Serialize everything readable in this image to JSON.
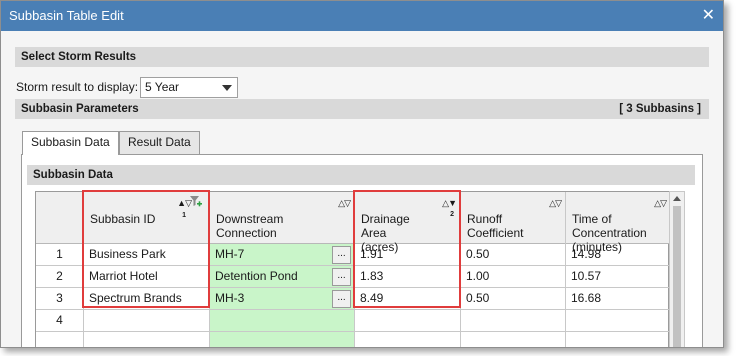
{
  "window": {
    "title": "Subbasin Table Edit",
    "close_glyph": "✕"
  },
  "storm": {
    "header": "Select Storm Results",
    "label": "Storm result to display:",
    "selected": "5 Year"
  },
  "params": {
    "header": "Subbasin Parameters",
    "count": "[ 3 Subbasins ]"
  },
  "tabs": [
    {
      "label": "Subbasin Data",
      "active": true
    },
    {
      "label": "Result Data",
      "active": false
    }
  ],
  "panel_header": "Subbasin Data",
  "columns": [
    {
      "label": "Subbasin ID",
      "sort": "▲▽",
      "sort_order": "1"
    },
    {
      "label": "Downstream\nConnection",
      "sort": "△▽"
    },
    {
      "label": "Drainage\nArea\n(acres)",
      "sort": "△▼",
      "sort_order": "2"
    },
    {
      "label": "Runoff\nCoefficient",
      "sort": "△▽"
    },
    {
      "label": "Time of\nConcentration\n(minutes)",
      "sort": "△▽"
    }
  ],
  "rows": [
    {
      "num": "1",
      "id": "Business Park",
      "conn": "MH-7",
      "area": "1.91",
      "coef": "0.50",
      "time": "14.98"
    },
    {
      "num": "2",
      "id": "Marriot Hotel",
      "conn": "Detention Pond",
      "area": "1.83",
      "coef": "1.00",
      "time": "10.57"
    },
    {
      "num": "3",
      "id": "Spectrum Brands",
      "conn": "MH-3",
      "area": "8.49",
      "coef": "0.50",
      "time": "16.68"
    },
    {
      "num": "4",
      "id": "",
      "conn": "",
      "area": "",
      "coef": "",
      "time": ""
    }
  ],
  "ellipsis": "...",
  "icons": {
    "filter": "filter-add-icon",
    "close": "close-icon",
    "dropdown": "chevron-down-icon"
  },
  "colors": {
    "titlebar": "#4a7fb5",
    "highlight": "#e03c3c",
    "connection_cell": "#c9f5c9"
  }
}
